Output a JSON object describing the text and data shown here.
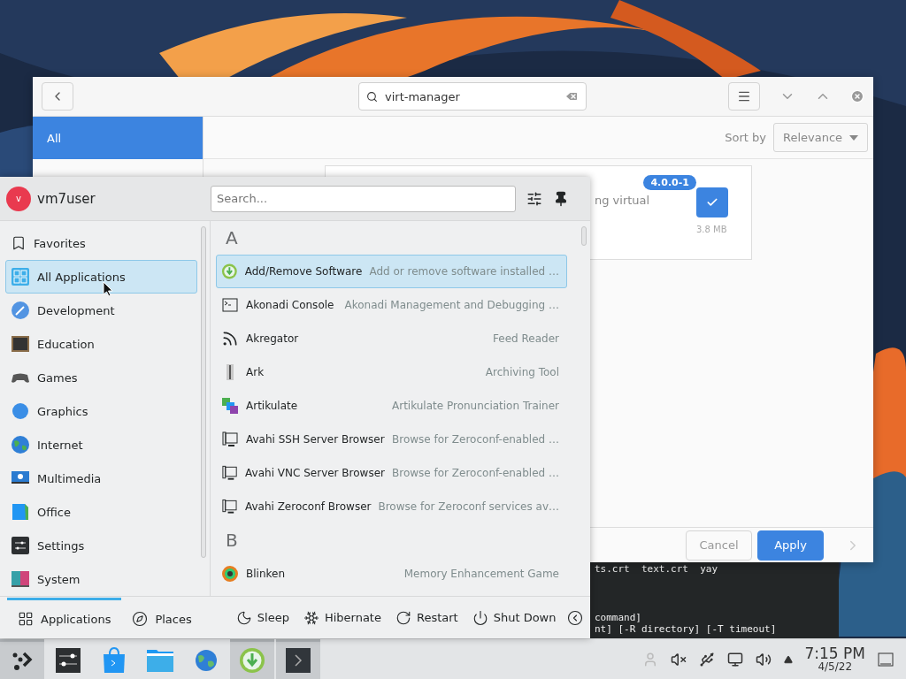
{
  "software_window": {
    "search": "virt-manager",
    "sidebar": [
      {
        "label": "All",
        "selected": true
      }
    ],
    "sort_label": "Sort by",
    "sort_value": "Relevance",
    "result": {
      "version": "4.0.0-1",
      "description": "ng virtual",
      "size": "3.8 MB",
      "installed": true
    },
    "buttons": [
      "Cancel",
      "Apply"
    ]
  },
  "terminal": {
    "lines": [
      "ts.crt  text.crt  yay",
      "command]",
      "nt] [-R directory] [-T timeout]"
    ]
  },
  "launcher": {
    "user": "vm7user",
    "avatar_letter": "v",
    "search_placeholder": "Search...",
    "categories": [
      {
        "label": "Favorites",
        "selected": false
      },
      {
        "label": "All Applications",
        "selected": true
      },
      {
        "label": "Development",
        "selected": false
      },
      {
        "label": "Education",
        "selected": false
      },
      {
        "label": "Games",
        "selected": false
      },
      {
        "label": "Graphics",
        "selected": false
      },
      {
        "label": "Internet",
        "selected": false
      },
      {
        "label": "Multimedia",
        "selected": false
      },
      {
        "label": "Office",
        "selected": false
      },
      {
        "label": "Settings",
        "selected": false
      },
      {
        "label": "System",
        "selected": false
      }
    ],
    "sections": [
      {
        "letter": "A",
        "apps": [
          {
            "name": "Add/Remove Software",
            "description": "Add or remove software installed …",
            "selected": true
          },
          {
            "name": "Akonadi Console",
            "description": "Akonadi Management and Debugging …",
            "selected": false
          },
          {
            "name": "Akregator",
            "description": "Feed Reader",
            "selected": false
          },
          {
            "name": "Ark",
            "description": "Archiving Tool",
            "selected": false
          },
          {
            "name": "Artikulate",
            "description": "Artikulate Pronunciation Trainer",
            "selected": false
          },
          {
            "name": "Avahi SSH Server Browser",
            "description": "Browse for Zeroconf-enabled …",
            "selected": false
          },
          {
            "name": "Avahi VNC Server Browser",
            "description": "Browse for Zeroconf-enabled …",
            "selected": false
          },
          {
            "name": "Avahi Zeroconf Browser",
            "description": "Browse for Zeroconf services av…",
            "selected": false
          }
        ]
      },
      {
        "letter": "B",
        "apps": [
          {
            "name": "Blinken",
            "description": "Memory Enhancement Game",
            "selected": false
          }
        ]
      }
    ],
    "tabs": [
      {
        "label": "Applications",
        "selected": true
      },
      {
        "label": "Places",
        "selected": false
      }
    ],
    "power": [
      {
        "label": "Sleep",
        "kind": "sleep"
      },
      {
        "label": "Hibernate",
        "kind": "hibernate"
      },
      {
        "label": "Restart",
        "kind": "restart"
      },
      {
        "label": "Shut Down",
        "kind": "shutdown"
      }
    ]
  },
  "taskbar": {
    "apps": [
      {
        "active": true
      },
      {
        "active": false
      },
      {
        "active": false
      },
      {
        "active": false
      },
      {
        "active": false
      },
      {
        "active": true
      },
      {
        "active": true
      }
    ],
    "time": "7:15 PM",
    "date": "4/5/22"
  }
}
